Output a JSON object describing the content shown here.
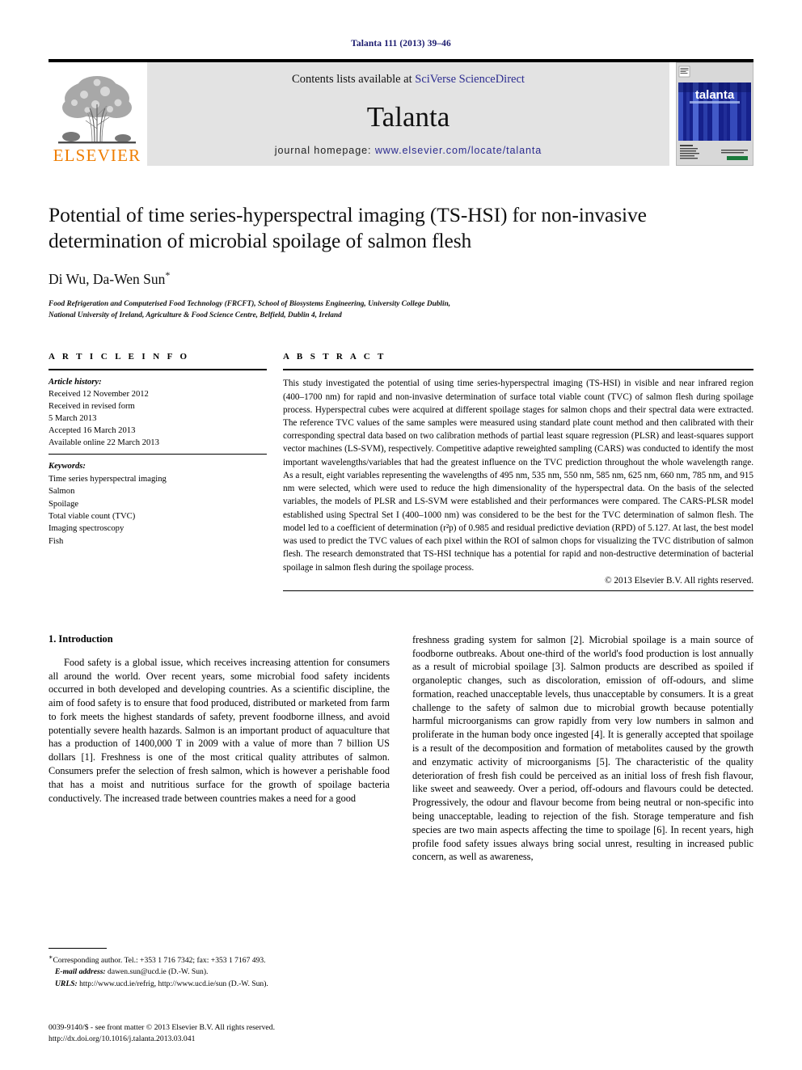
{
  "running_head": "Talanta 111 (2013) 39–46",
  "masthead": {
    "contents_prefix": "Contents lists available at ",
    "contents_link": "SciVerse ScienceDirect",
    "journal_title": "Talanta",
    "homepage_prefix": "journal homepage: ",
    "homepage_link": "www.elsevier.com/locate/talanta",
    "publisher_wordmark": "ELSEVIER",
    "publisher_logo_icon": "elsevier-tree-icon",
    "cover_wordmark": "talanta",
    "colors": {
      "link": "#2b2b8f",
      "elsevier_orange": "#ef7d00",
      "masthead_background": "#e3e3e3",
      "running_head": "#1a1a6e",
      "cover_blue": "#1c2f8c"
    }
  },
  "article": {
    "title": "Potential of time series-hyperspectral imaging (TS-HSI) for non-invasive determination of microbial spoilage of salmon flesh",
    "authors": "Di Wu, Da-Wen Sun",
    "author_marker": "*",
    "affiliation_line1": "Food Refrigeration and Computerised Food Technology (FRCFT), School of Biosystems Engineering, University College Dublin,",
    "affiliation_line2": "National University of Ireland, Agriculture & Food Science Centre, Belfield, Dublin 4, Ireland"
  },
  "article_info": {
    "heading": "A R T I C L E  I N F O",
    "history_label": "Article history:",
    "history": [
      "Received 12 November 2012",
      "Received in revised form",
      "5 March 2013",
      "Accepted 16 March 2013",
      "Available online 22 March 2013"
    ],
    "keywords_label": "Keywords:",
    "keywords": [
      "Time series hyperspectral imaging",
      "Salmon",
      "Spoilage",
      "Total viable count (TVC)",
      "Imaging spectroscopy",
      "Fish"
    ]
  },
  "abstract": {
    "heading": "A B S T R A C T",
    "text": "This study investigated the potential of using time series-hyperspectral imaging (TS-HSI) in visible and near infrared region (400–1700 nm) for rapid and non-invasive determination of surface total viable count (TVC) of salmon flesh during spoilage process. Hyperspectral cubes were acquired at different spoilage stages for salmon chops and their spectral data were extracted. The reference TVC values of the same samples were measured using standard plate count method and then calibrated with their corresponding spectral data based on two calibration methods of partial least square regression (PLSR) and least-squares support vector machines (LS-SVM), respectively. Competitive adaptive reweighted sampling (CARS) was conducted to identify the most important wavelengths/variables that had the greatest influence on the TVC prediction throughout the whole wavelength range. As a result, eight variables representing the wavelengths of 495 nm, 535 nm, 550 nm, 585 nm, 625 nm, 660 nm, 785 nm, and 915 nm were selected, which were used to reduce the high dimensionality of the hyperspectral data. On the basis of the selected variables, the models of PLSR and LS-SVM were established and their performances were compared. The CARS-PLSR model established using Spectral Set I (400–1000 nm) was considered to be the best for the TVC determination of salmon flesh. The model led to a coefficient of determination (r²p) of 0.985 and residual predictive deviation (RPD) of 5.127. At last, the best model was used to predict the TVC values of each pixel within the ROI of salmon chops for visualizing the TVC distribution of salmon flesh. The research demonstrated that TS-HSI technique has a potential for rapid and non-destructive determination of bacterial spoilage in salmon flesh during the spoilage process.",
    "copyright": "© 2013 Elsevier B.V. All rights reserved."
  },
  "introduction": {
    "section_number_title": "1.  Introduction",
    "left_paragraph": "Food safety is a global issue, which receives increasing attention for consumers all around the world. Over recent years, some microbial food safety incidents occurred in both developed and developing countries. As a scientific discipline, the aim of food safety is to ensure that food produced, distributed or marketed from farm to fork meets the highest standards of safety, prevent foodborne illness, and avoid potentially severe health hazards. Salmon is an important product of aquaculture that has a production of 1400,000 T in 2009 with a value of more than 7 billion US dollars [1]. Freshness is one of the most critical quality attributes of salmon. Consumers prefer the selection of fresh salmon, which is however a perishable food that has a moist and nutritious surface for the growth of spoilage bacteria conductively. The increased trade between countries makes a need for a good",
    "right_paragraph": "freshness grading system for salmon [2]. Microbial spoilage is a main source of foodborne outbreaks. About one-third of the world's food production is lost annually as a result of microbial spoilage [3]. Salmon products are described as spoiled if organoleptic changes, such as discoloration, emission of off-odours, and slime formation, reached unacceptable levels, thus unacceptable by consumers. It is a great challenge to the safety of salmon due to microbial growth because potentially harmful microorganisms can grow rapidly from very low numbers in salmon and proliferate in the human body once ingested [4]. It is generally accepted that spoilage is a result of the decomposition and formation of metabolites caused by the growth and enzymatic activity of microorganisms [5]. The characteristic of the quality deterioration of fresh fish could be perceived as an initial loss of fresh fish flavour, like sweet and seaweedy. Over a period, off-odours and flavours could be detected. Progressively, the odour and flavour become from being neutral or non-specific into being unacceptable, leading to rejection of the fish. Storage temperature and fish species are two main aspects affecting the time to spoilage [6]. In recent years, high profile food safety issues always bring social unrest, resulting in increased public concern, as well as awareness,"
  },
  "footnotes": {
    "corresponding": "Corresponding author. Tel.: +353 1 716 7342; fax: +353 1 7167 493.",
    "email_label": "E-mail address:",
    "email_value": "dawen.sun@ucd.ie (D.-W. Sun).",
    "urls_label": "URLS:",
    "urls_value": "http://www.ucd.ie/refrig, http://www.ucd.ie/sun (D.-W. Sun)."
  },
  "imprint": {
    "line1": "0039-9140/$ - see front matter © 2013 Elsevier B.V. All rights reserved.",
    "line2": "http://dx.doi.org/10.1016/j.talanta.2013.03.041"
  }
}
